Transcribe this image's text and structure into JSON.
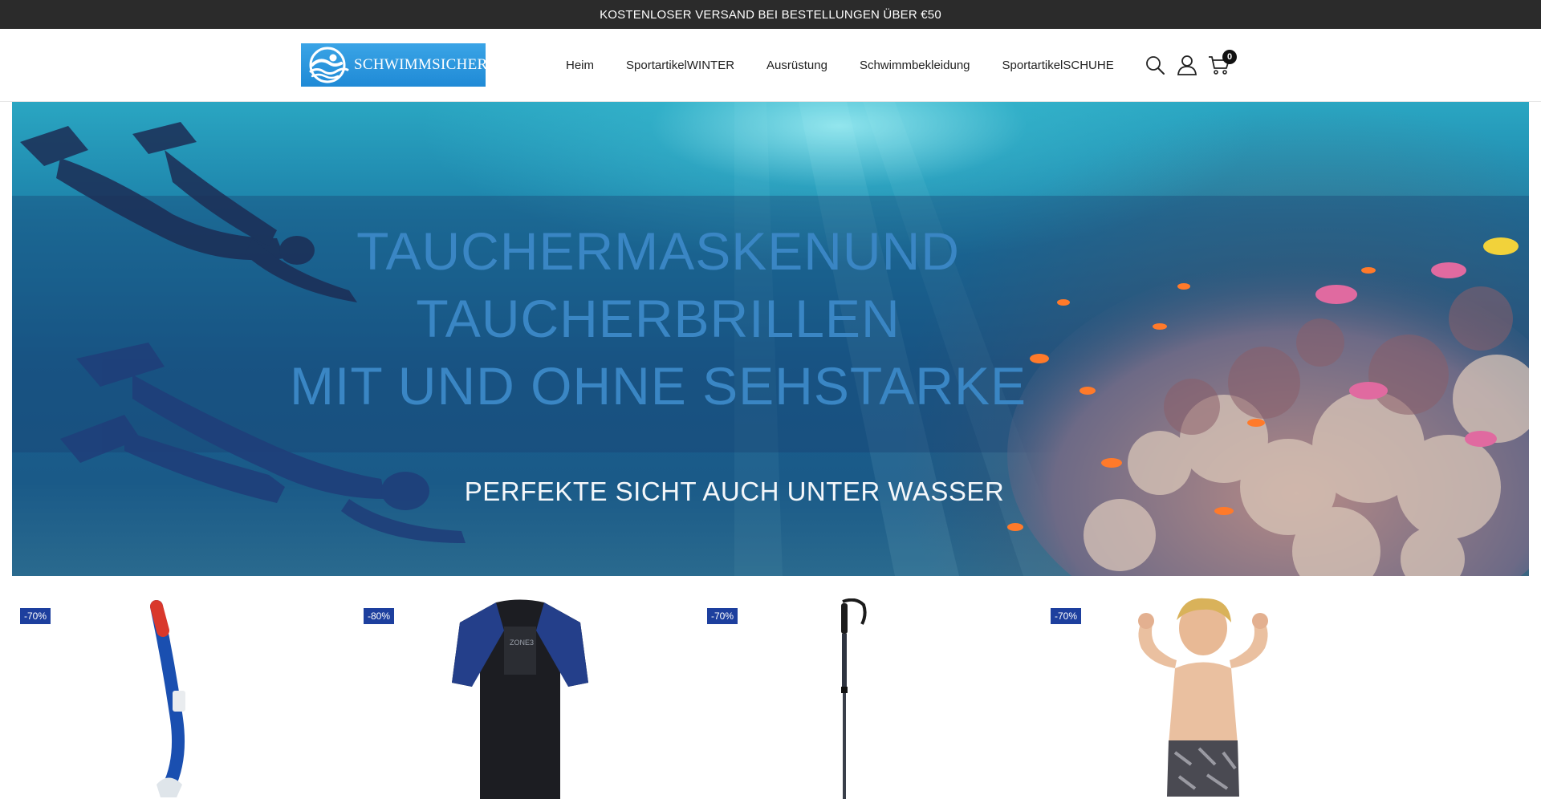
{
  "announcement": {
    "text": "KOSTENLOSER VERSAND BEI BESTELLUNGEN ÜBER €50"
  },
  "header": {
    "logo_text": "SCHWIMMSICHER",
    "nav": [
      {
        "label": "Heim"
      },
      {
        "label": "SportartikelWINTER"
      },
      {
        "label": "Ausrüstung"
      },
      {
        "label": "Schwimmbekleidung"
      },
      {
        "label": "SportartikelSCHUHE"
      }
    ],
    "icons": [
      "search-icon",
      "account-icon",
      "cart-icon"
    ],
    "cart_count": "0"
  },
  "hero": {
    "title_lines": [
      "TAUCHERMASKENUND",
      "TAUCHERBRILLEN",
      "MIT UND OHNE SEHSTARKE"
    ],
    "subtitle": "PERFEKTE SICHT AUCH UNTER WASSER"
  },
  "products": [
    {
      "discount": "-70%",
      "image": "snorkel"
    },
    {
      "discount": "-80%",
      "image": "wetsuit"
    },
    {
      "discount": "-70%",
      "image": "trekking-pole"
    },
    {
      "discount": "-70%",
      "image": "kids-swim-jammer"
    }
  ],
  "colors": {
    "topbar_bg": "#2b2b2b",
    "badge_bg": "#1d3f9e",
    "logo_bg": "#2a96de",
    "hero_title": "#3a86c4"
  }
}
